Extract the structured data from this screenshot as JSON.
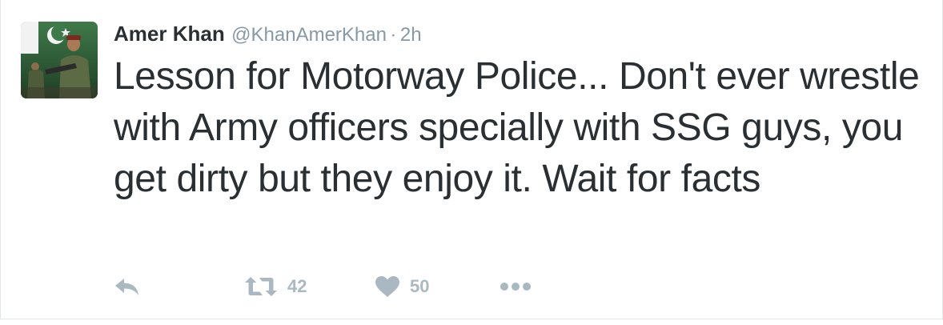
{
  "tweet": {
    "author": {
      "name": "Amer Khan",
      "handle": "@KhanAmerKhan",
      "avatar_icon": "profile-photo-soldier-flag"
    },
    "separator": "·",
    "time": "2h",
    "text": "Lesson for Motorway Police... Don't ever wrestle with Army officers specially with SSG guys, you get dirty but they enjoy it. Wait for facts",
    "actions": {
      "reply_icon": "reply-icon",
      "retweet_icon": "retweet-icon",
      "retweet_count": "42",
      "like_icon": "heart-icon",
      "like_count": "50",
      "more_icon": "more-icon"
    }
  },
  "colors": {
    "text": "#292f33",
    "muted": "#8899a6",
    "action": "#aab8c2",
    "border": "#e1e8ed"
  }
}
